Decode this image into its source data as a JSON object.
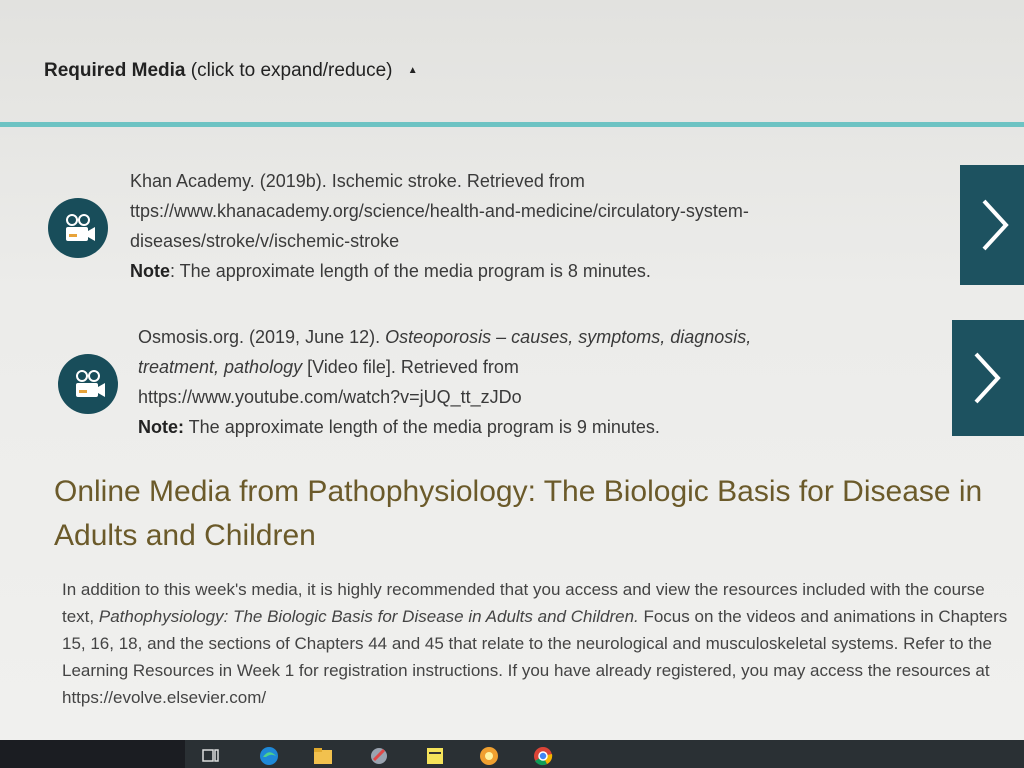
{
  "required_media": {
    "title": "Required Media",
    "hint": "(click to expand/reduce)",
    "toggle_icon": "▲"
  },
  "media_items": [
    {
      "line1": "Khan Academy. (2019b). Ischemic stroke. Retrieved from",
      "line2": "ttps://www.khanacademy.org/science/health-and-medicine/circulatory-system-",
      "line3": "diseases/stroke/v/ischemic-stroke",
      "note_label": "Note",
      "note_text": ": The approximate length of the media program is 8 minutes."
    },
    {
      "line1_plain": "Osmosis.org. (2019, June 12). ",
      "line1_italic": "Osteoporosis – causes, symptoms, diagnosis,",
      "line2_italic": "treatment, pathology",
      "line2_plain": " [Video file]. Retrieved from",
      "line3": "https://www.youtube.com/watch?v=jUQ_tt_zJDo",
      "note_label": "Note:",
      "note_text": " The approximate length of the media program is 9 minutes."
    }
  ],
  "section": {
    "title_line1": "Online Media from Pathophysiology: The Biologic Basis for Disease in",
    "title_line2": "Adults and Children"
  },
  "body": {
    "p1": "In addition to this week's media, it is highly recommended that you access and view the resources included with the course text, ",
    "italic": "Pathophysiology: The Biologic Basis for Disease in Adults and Children.",
    "p2": " Focus on the videos and animations in Chapters 15, 16, 18, and the sections of Chapters 44 and 45 that relate to the neurological and musculoskeletal systems. Refer to the Learning Resources in Week 1 for registration instructions. If you have already registered, you may access the resources at https://evolve.elsevier.com/"
  },
  "taskbar": {
    "icons": [
      "task-view-icon",
      "edge-icon",
      "file-explorer-icon",
      "app-icon",
      "notes-icon",
      "media-icon",
      "chrome-icon"
    ]
  }
}
